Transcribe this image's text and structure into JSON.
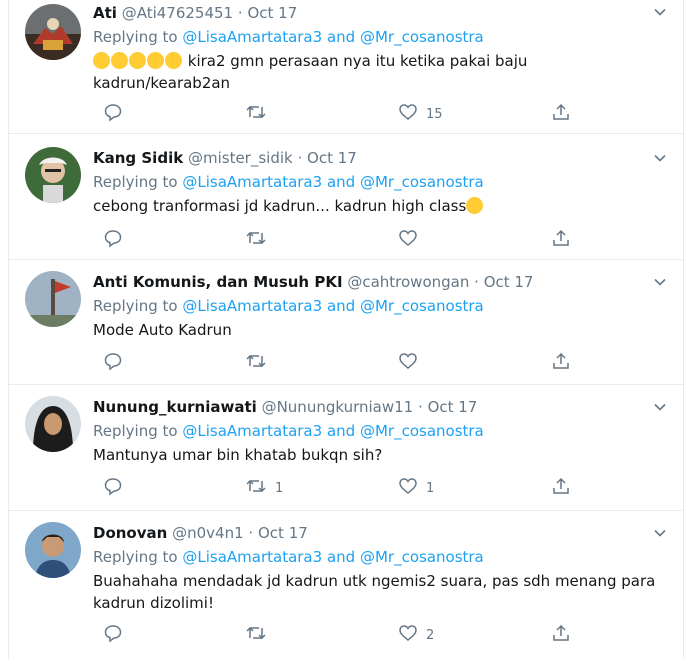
{
  "tweets": [
    {
      "name": "Ati",
      "handle": "@Ati47625451",
      "dot": "·",
      "date": "Oct 17",
      "replying_label": "Replying to",
      "mention1": "@LisaAmartatara3",
      "and_label": "and",
      "mention2": "@Mr_cosanostra",
      "emoji_prefix": [
        "rolling-on-floor-laughing-emoji",
        "rolling-on-floor-laughing-emoji",
        "rolling-on-floor-laughing-emoji",
        "rolling-on-floor-laughing-emoji",
        "rolling-on-floor-laughing-emoji"
      ],
      "text": "kira2 gmn perasaan nya itu ketika pakai baju kadrun/kearab2an",
      "reply_count": "",
      "retweet_count": "",
      "like_count": "15"
    },
    {
      "name": "Kang Sidik",
      "handle": "@mister_sidik",
      "dot": "·",
      "date": "Oct 17",
      "replying_label": "Replying to",
      "mention1": "@LisaAmartatara3",
      "and_label": "and",
      "mention2": "@Mr_cosanostra",
      "text": "cebong tranformasi jd kadrun... kadrun high class",
      "emoji_suffix": "grinning-face-emoji",
      "reply_count": "",
      "retweet_count": "",
      "like_count": ""
    },
    {
      "name": "Anti Komunis, dan Musuh PKI",
      "handle": "@cahtrowongan",
      "dot": "·",
      "date": "Oct 17",
      "replying_label": "Replying to",
      "mention1": "@LisaAmartatara3",
      "and_label": "and",
      "mention2": "@Mr_cosanostra",
      "text": "Mode Auto Kadrun",
      "reply_count": "",
      "retweet_count": "",
      "like_count": ""
    },
    {
      "name": "Nunung_kurniawati",
      "handle": "@Nunungkurniaw11",
      "dot": "·",
      "date": "Oct 17",
      "replying_label": "Replying to",
      "mention1": "@LisaAmartatara3",
      "and_label": "and",
      "mention2": "@Mr_cosanostra",
      "text": "Mantunya umar bin khatab bukqn sih?",
      "reply_count": "",
      "retweet_count": "1",
      "like_count": "1"
    },
    {
      "name": "Donovan",
      "handle": "@n0v4n1",
      "dot": "·",
      "date": "Oct 17",
      "replying_label": "Replying to",
      "mention1": "@LisaAmartatara3",
      "and_label": "and",
      "mention2": "@Mr_cosanostra",
      "text": "Buahahaha mendadak jd kadrun utk ngemis2 suara, pas sdh menang para kadrun dizolimi!",
      "reply_count": "",
      "retweet_count": "",
      "like_count": "2"
    }
  ],
  "colors": {
    "name": "#14171a",
    "meta": "#657786",
    "mention": "#1da1f2",
    "divider": "#e6ecf0",
    "emoji": "#ffcc33"
  },
  "icons": {
    "reply": "reply-icon",
    "retweet": "retweet-icon",
    "like": "heart-icon",
    "share": "share-icon",
    "menu": "chevron-down-icon"
  }
}
